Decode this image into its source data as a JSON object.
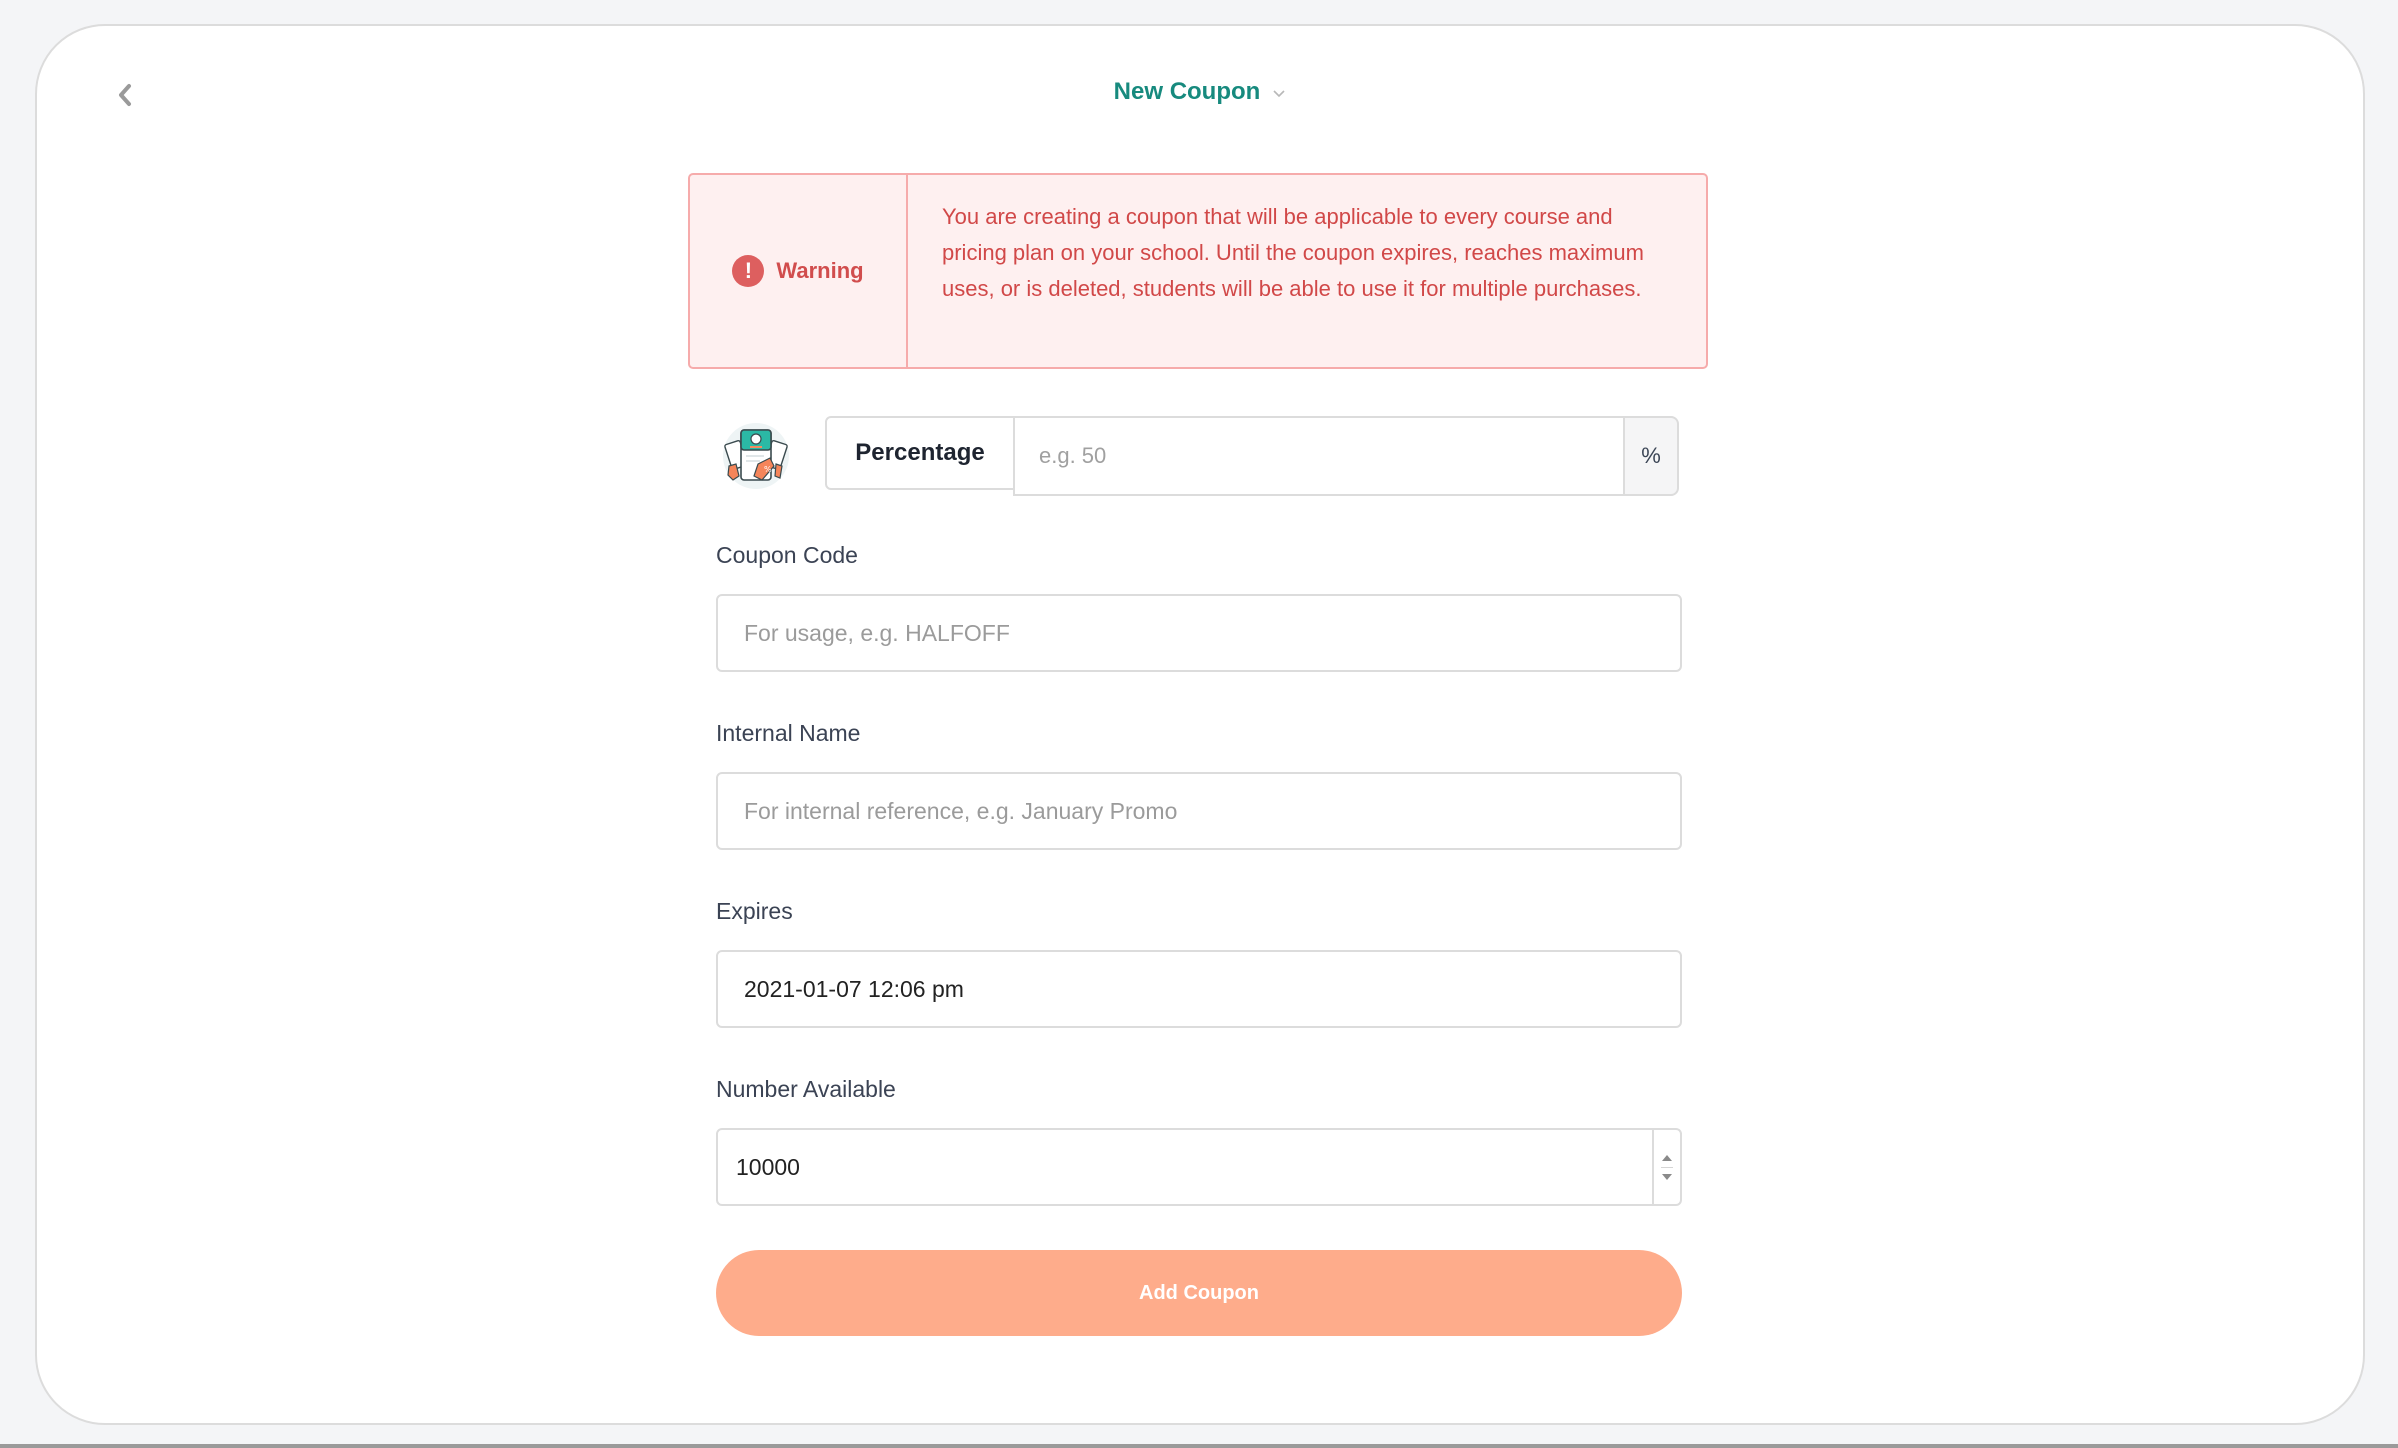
{
  "header": {
    "back_icon": "chevron-left-icon",
    "title": "New Coupon",
    "title_dropdown_icon": "chevron-down-icon"
  },
  "warning": {
    "icon": "exclamation-circle-icon",
    "label": "Warning",
    "message": "You are creating a coupon that will be applicable to every course and pricing plan on your school. Until the coupon expires, reaches maximum uses, or is deleted, students will be able to use it for multiple purchases."
  },
  "discount": {
    "illustration": "coupon-tags-illustration",
    "type_label": "Percentage",
    "amount_value": "",
    "amount_placeholder": "e.g. 50",
    "suffix": "%"
  },
  "form": {
    "coupon_code": {
      "label": "Coupon Code",
      "value": "",
      "placeholder": "For usage, e.g. HALFOFF"
    },
    "internal_name": {
      "label": "Internal Name",
      "value": "",
      "placeholder": "For internal reference, e.g. January Promo"
    },
    "expires": {
      "label": "Expires",
      "value": "2021-01-07 12:06 pm",
      "placeholder": ""
    },
    "number_available": {
      "label": "Number Available",
      "value": "10000"
    }
  },
  "actions": {
    "submit_label": "Add Coupon"
  },
  "colors": {
    "title": "#178a7e",
    "warning_text": "#d14848",
    "warning_bg": "#fef0f0",
    "warning_border": "#f6abab",
    "button_bg": "#feac8b",
    "page_bg": "#f4f5f7"
  }
}
